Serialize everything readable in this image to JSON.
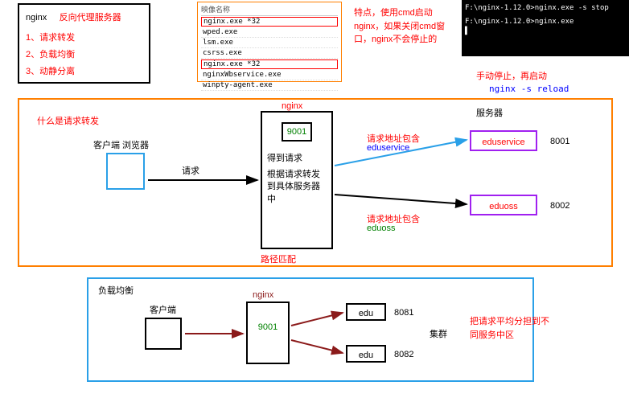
{
  "info": {
    "title_left": "nginx",
    "title_right": "反向代理服务器",
    "item1": "1、请求转发",
    "item2": "2、负载均衡",
    "item3": "3、动静分离"
  },
  "task": {
    "header": "映像名称",
    "row_hl1": "nginx.exe *32",
    "row2": "wped.exe",
    "row3": "lsm.exe",
    "row4": "csrss.exe",
    "row_hl2": "nginx.exe *32",
    "row6": "nginxWbservice.exe",
    "row7": "winpty-agent.exe"
  },
  "notes": {
    "cmd1": "特点，使用cmd启动",
    "cmd2": "nginx，如果关闭cmd窗",
    "cmd3": "口，nginx不会停止的",
    "stop": "手动停止，再启动",
    "reload": "nginx  -s reload"
  },
  "term": {
    "l1": "F:\\nginx-1.12.0>nginx.exe -s stop",
    "l2": "F:\\nginx-1.12.0>nginx.exe",
    "cursor": "▌"
  },
  "main": {
    "q": "什么是请求转发",
    "client": "客户端 浏览器",
    "req": "请求",
    "nginx_lbl": "nginx",
    "port": "9001",
    "got": "得到请求",
    "route1": "根据请求转发",
    "route2": "到具体服务器",
    "route3": "中",
    "path": "路径匹配",
    "servers_lbl": "服务器",
    "addr_inc": "请求地址包含",
    "svc1_key": "eduservice",
    "svc1": "eduservice",
    "svc1_port": "8001",
    "svc2_key": "eduoss",
    "svc2": "eduoss",
    "svc2_port": "8002"
  },
  "lb": {
    "title": "负载均衡",
    "client": "客户端",
    "nginx_lbl": "nginx",
    "port": "9001",
    "svc": "edu",
    "p1": "8081",
    "p2": "8082",
    "cluster": "集群",
    "note1": "把请求平均分担到不",
    "note2": "同服务中区"
  }
}
